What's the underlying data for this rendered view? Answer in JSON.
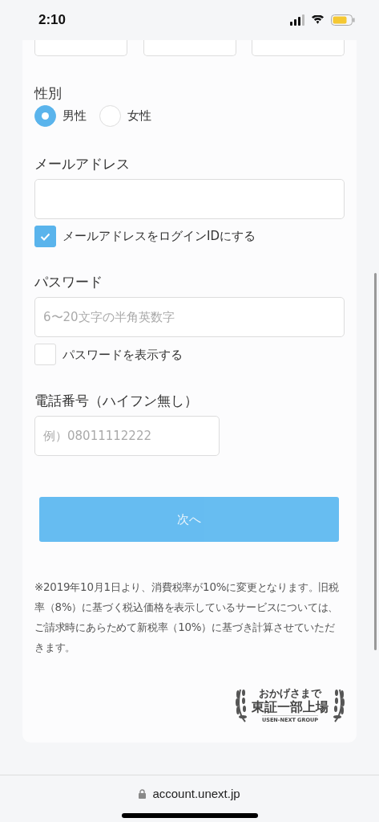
{
  "status_bar": {
    "time": "2:10"
  },
  "gender": {
    "label": "性別",
    "options": [
      {
        "label": "男性",
        "selected": true
      },
      {
        "label": "女性",
        "selected": false
      }
    ]
  },
  "email": {
    "label": "メールアドレス",
    "use_as_login": {
      "label": "メールアドレスをログインIDにする",
      "checked": true
    }
  },
  "password": {
    "label": "パスワード",
    "placeholder": "6〜20文字の半角英数字",
    "show": {
      "label": "パスワードを表示する",
      "checked": false
    }
  },
  "phone": {
    "label": "電話番号（ハイフン無し）",
    "placeholder": "例）08011112222"
  },
  "next_button": {
    "label": "次へ",
    "disabled": true
  },
  "notice": "※2019年10月1日より、消費税率が10%に変更となります。旧税率（8%）に基づく税込価格を表示しているサービスについては、ご請求時にあらためて新税率（10%）に基づき計算させていただきます。",
  "badge": {
    "top": "おかげさまで",
    "main": "東証一部上場",
    "bottom": "USEN-NEXT GROUP"
  },
  "browser": {
    "url": "account.unext.jp"
  }
}
